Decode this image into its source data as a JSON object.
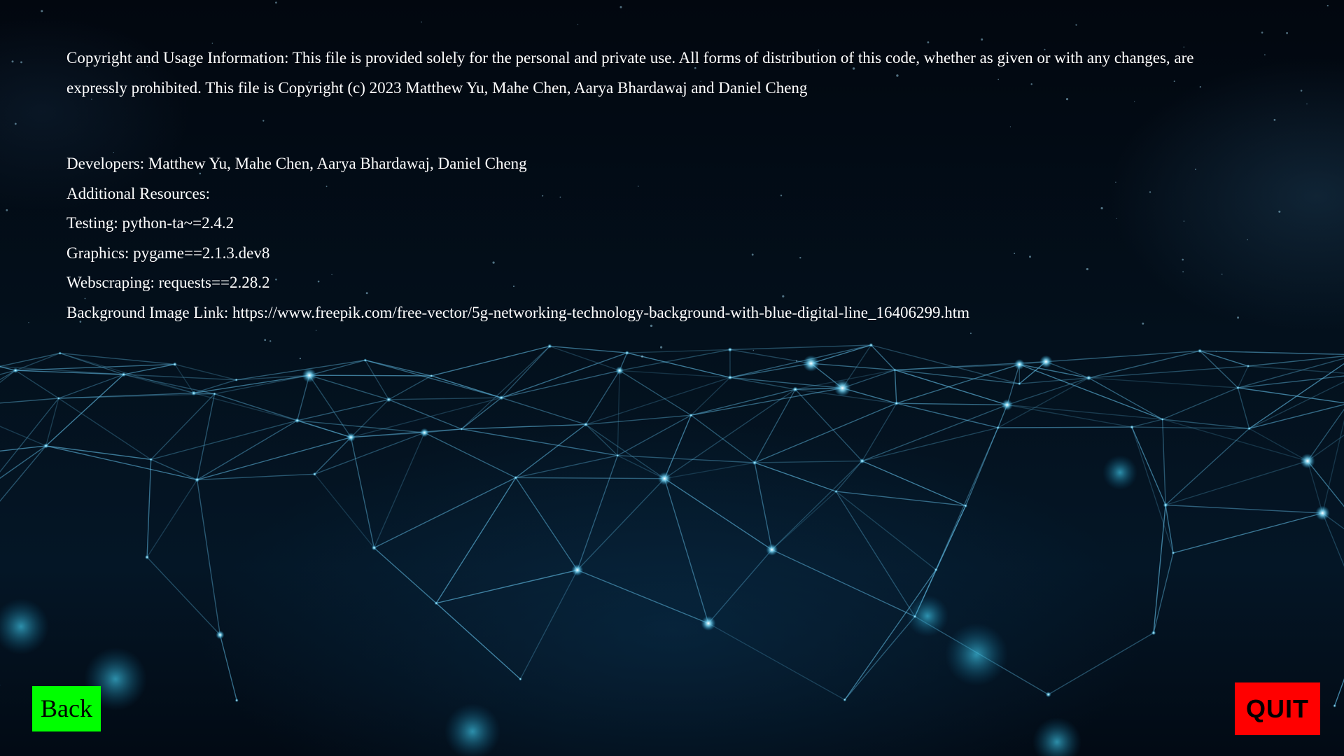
{
  "info": {
    "copyright": "Copyright and Usage Information: This file is provided solely for the personal and private use. All forms of distribution of this code, whether as given or with any changes, are expressly prohibited. This file is Copyright (c) 2023 Matthew Yu, Mahe Chen, Aarya Bhardawaj and Daniel Cheng",
    "developers": "Developers: Matthew Yu, Mahe Chen, Aarya Bhardawaj, Daniel Cheng",
    "additional_resources": "Additional Resources:",
    "testing": "Testing: python-ta~=2.4.2",
    "graphics": "Graphics: pygame==2.1.3.dev8",
    "webscraping": "Webscraping: requests==2.28.2",
    "background_link": "Background Image Link: https://www.freepik.com/free-vector/5g-networking-technology-background-with-blue-digital-line_16406299.htm"
  },
  "buttons": {
    "back_label": "Back",
    "quit_label": "QUIT"
  },
  "colors": {
    "back_bg": "#00ff00",
    "quit_bg": "#ff0000",
    "text": "#ffffff",
    "network_line": "#5fb8e0",
    "network_node": "#bff0ff"
  }
}
